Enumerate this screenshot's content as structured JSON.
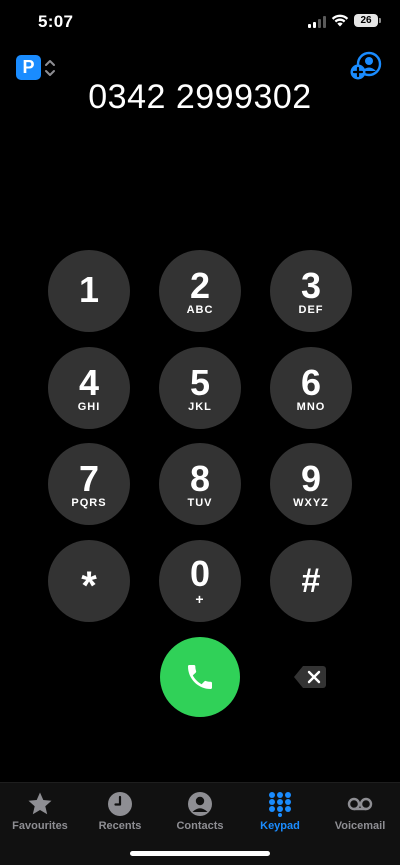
{
  "status_bar": {
    "time": "5:07",
    "battery": "26"
  },
  "header": {
    "line_badge": "P",
    "dialed_number": "0342 2999302"
  },
  "keypad": {
    "keys": [
      {
        "digit": "1",
        "letters": ""
      },
      {
        "digit": "2",
        "letters": "ABC"
      },
      {
        "digit": "3",
        "letters": "DEF"
      },
      {
        "digit": "4",
        "letters": "GHI"
      },
      {
        "digit": "5",
        "letters": "JKL"
      },
      {
        "digit": "6",
        "letters": "MNO"
      },
      {
        "digit": "7",
        "letters": "PQRS"
      },
      {
        "digit": "8",
        "letters": "TUV"
      },
      {
        "digit": "9",
        "letters": "WXYZ"
      },
      {
        "digit": "*",
        "letters": ""
      },
      {
        "digit": "0",
        "letters": "+"
      },
      {
        "digit": "#",
        "letters": ""
      }
    ]
  },
  "tab_bar": {
    "tabs": [
      {
        "label": "Favourites",
        "icon": "star-icon"
      },
      {
        "label": "Recents",
        "icon": "clock-icon"
      },
      {
        "label": "Contacts",
        "icon": "person-circle-icon"
      },
      {
        "label": "Keypad",
        "icon": "keypad-icon",
        "active": true
      },
      {
        "label": "Voicemail",
        "icon": "voicemail-icon"
      }
    ]
  },
  "colors": {
    "accent": "#1a8cff",
    "call_green": "#30d158",
    "key_gray": "#333333",
    "inactive_tab": "#8e8e93"
  }
}
